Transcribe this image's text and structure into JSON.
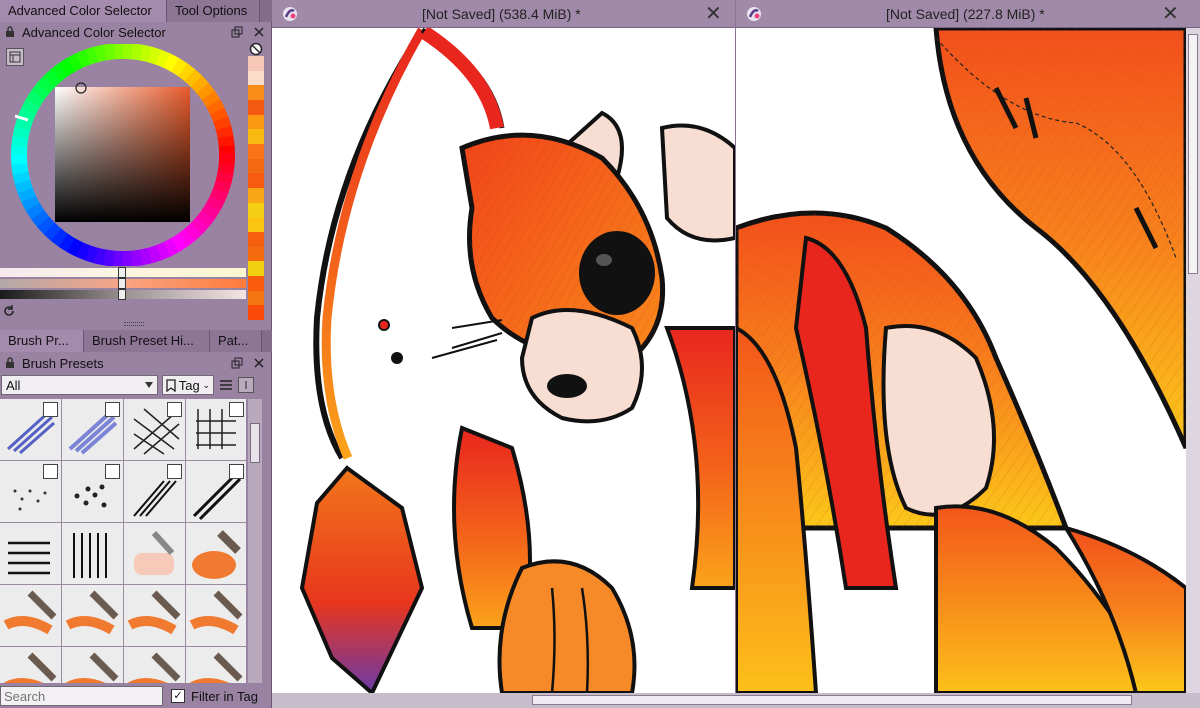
{
  "left_dock": {
    "top_tabs": [
      "Advanced Color Selector",
      "Tool Options"
    ],
    "color_panel_title": "Advanced Color Selector",
    "color_strip": [
      "#f7c8b8",
      "#fbdcc8",
      "#fa8d1a",
      "#f55a14",
      "#fb9a10",
      "#f8ba12",
      "#fa7314",
      "#f46a12",
      "#f95a12",
      "#f8a614",
      "#f4d015",
      "#fbc40f",
      "#f65f10",
      "#f36b0d",
      "#f0d010",
      "#fa5b0d",
      "#f47512",
      "#fa4b0a"
    ],
    "mid_tabs": [
      "Brush Pr...",
      "Brush Preset Hi...",
      "Pat..."
    ],
    "brush_panel_title": "Brush Presets",
    "filter_value": "All",
    "tag_label": "Tag",
    "search_placeholder": "Search",
    "filter_in_tag_label": "Filter in Tag"
  },
  "views": [
    {
      "title": "[Not Saved]  (538.4 MiB) *"
    },
    {
      "title": "[Not Saved]  (227.8 MiB) *"
    }
  ],
  "accent": "#f0501a"
}
